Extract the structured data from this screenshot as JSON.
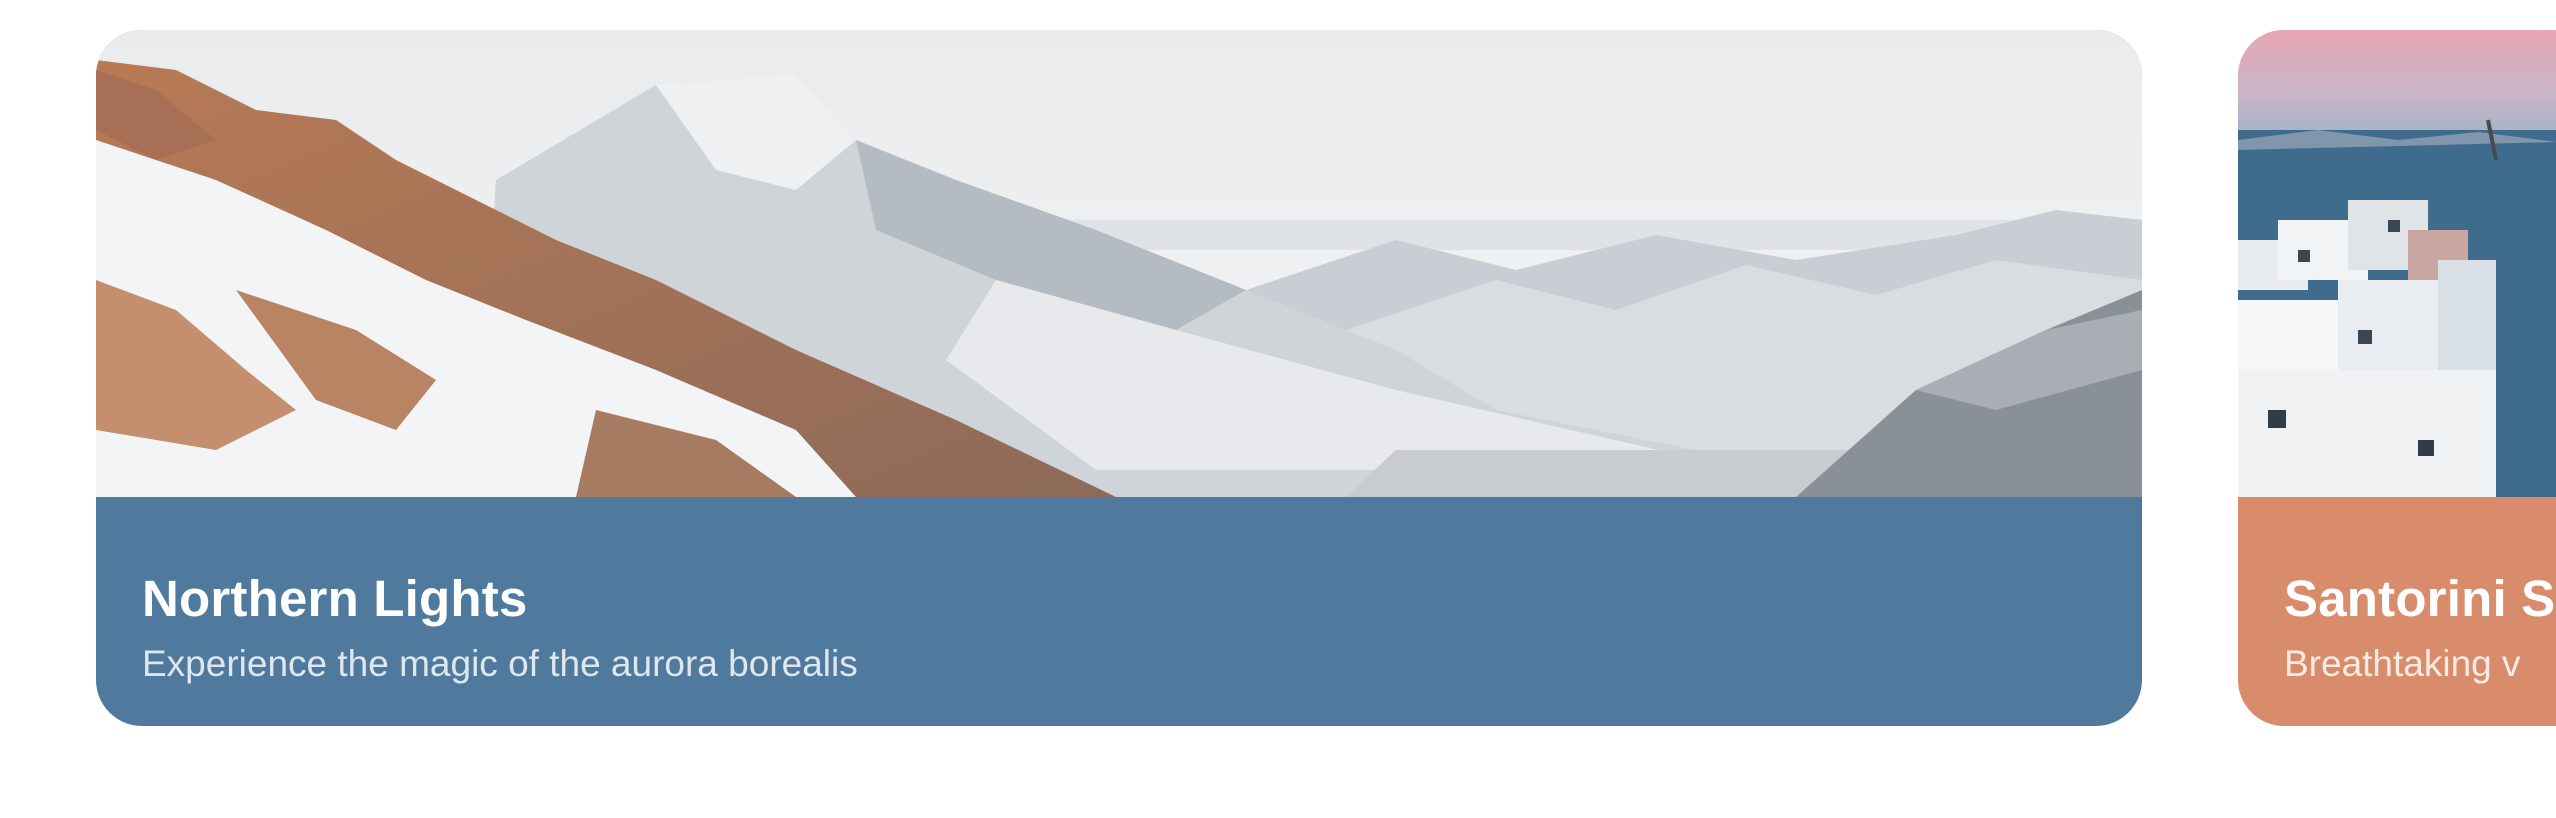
{
  "carousel": {
    "cards": [
      {
        "title": "Northern Lights",
        "subtitle": "Experience the magic of the aurora borealis",
        "image": "snowy-mountain-range-photo",
        "color": "#4f7a9e"
      },
      {
        "title": "Santorini S",
        "subtitle": "Breathtaking v",
        "image": "santorini-village-sunset-photo",
        "color": "#d98c6b"
      }
    ]
  }
}
